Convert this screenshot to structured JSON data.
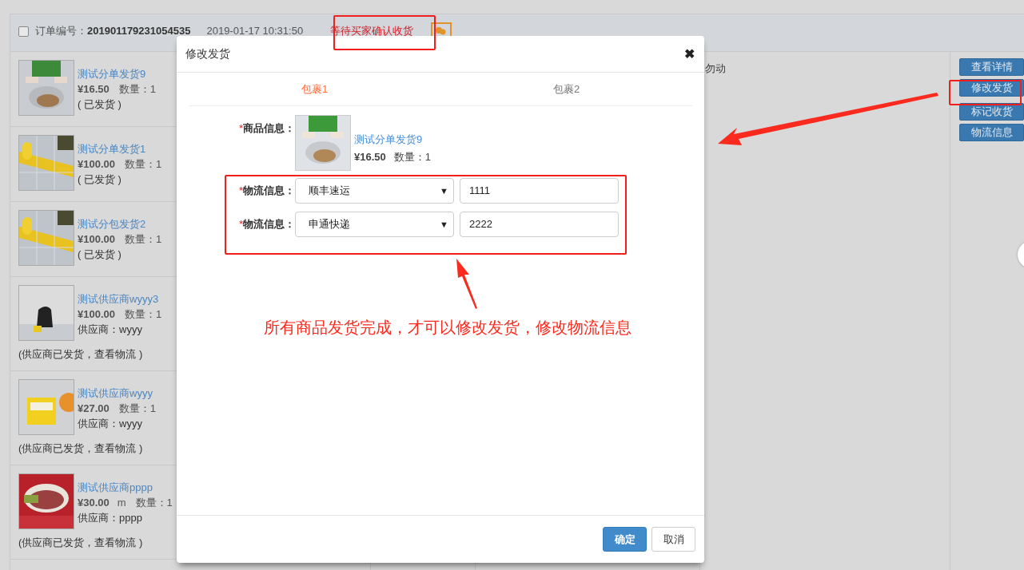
{
  "order": {
    "checked": false,
    "number_label": "订单编号：",
    "number": "201901179231054535",
    "time": "2019-01-17 10:31:50",
    "status": "等待买家确认收货"
  },
  "items": [
    {
      "kind": "shipped",
      "name": "测试分单发货9",
      "price": "¥16.50",
      "qty": "数量：1",
      "note": "( 已发货 )"
    },
    {
      "kind": "shipped",
      "name": "测试分单发货1",
      "price": "¥100.00",
      "qty": "数量：1",
      "note": "( 已发货 )"
    },
    {
      "kind": "shipped",
      "name": "测试分包发货2",
      "price": "¥100.00",
      "qty": "数量：1",
      "note": "( 已发货 )"
    },
    {
      "kind": "supplier",
      "name": "测试供应商wyyy3",
      "price": "¥100.00",
      "qty": "数量：1",
      "supplier": "供应商：wyyy",
      "note": "(供应商已发货，查看物流 )"
    },
    {
      "kind": "supplier",
      "name": "测试供应商wyyy",
      "price": "¥27.00",
      "qty": "数量：1",
      "supplier": "供应商：wyyy",
      "note": "(供应商已发货，查看物流 )"
    },
    {
      "kind": "supplier",
      "name": "测试供应商pppp",
      "price": "¥30.00",
      "unit": "m",
      "qty": "数量：1",
      "supplier": "供应商：pppp",
      "note": "(供应商已发货，查看物流 )"
    }
  ],
  "remark": "勿动",
  "actions": [
    {
      "label": "查看详情"
    },
    {
      "label": "修改发货"
    },
    {
      "label": "标记收货"
    },
    {
      "label": "物流信息"
    }
  ],
  "modal": {
    "title": "修改发货",
    "close": "✖",
    "tabs": [
      {
        "label": "包裹1",
        "selected": true
      },
      {
        "label": "包裹2",
        "selected": false
      }
    ],
    "product_mark": "*",
    "product_label": "商品信息：",
    "product": {
      "name": "测试分单发货9",
      "price": "¥16.50",
      "qty": "数量：1"
    },
    "shipments": [
      {
        "mark": "*",
        "label": "物流信息：",
        "carrier": "顺丰速运",
        "caret": "▼",
        "tracking": "1111"
      },
      {
        "mark": "*",
        "label": "物流信息：",
        "carrier": "申通快递",
        "caret": "▼",
        "tracking": "2222"
      }
    ],
    "confirm": "确定",
    "cancel": "取消"
  },
  "annotation": "所有商品发货完成，才可以修改发货，修改物流信息"
}
